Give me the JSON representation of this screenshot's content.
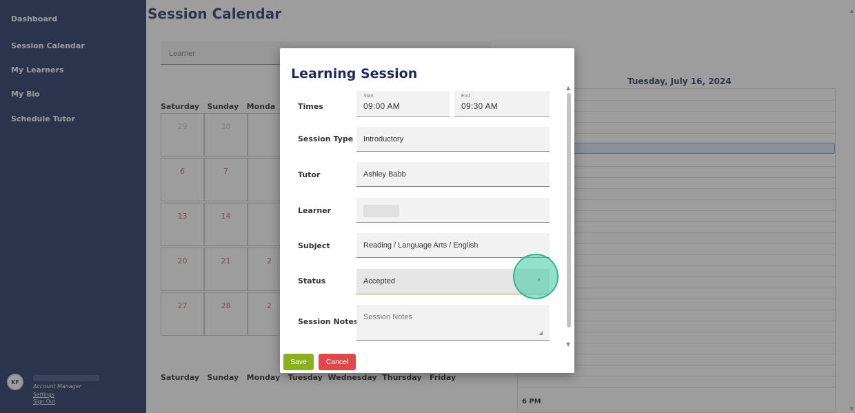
{
  "sidebar": {
    "items": [
      {
        "label": "Dashboard"
      },
      {
        "label": "Session Calendar"
      },
      {
        "label": "My Learners"
      },
      {
        "label": "My Bio"
      },
      {
        "label": "Schedule Tutor"
      }
    ],
    "account": {
      "initials": "KF",
      "role": "Account Manager",
      "settings": "Settings",
      "sign_out": "Sign Out"
    }
  },
  "page": {
    "title": "Session Calendar",
    "learner_placeholder": "Learner"
  },
  "calendar": {
    "header": "Saturday   Sunday   Monda",
    "bottom_header": "Saturday   Sunday   Monday   Tuesday  Wednesday  Thursday   Friday",
    "rows": [
      [
        "29",
        "30",
        ""
      ],
      [
        "6",
        "7",
        ""
      ],
      [
        "13",
        "14",
        ""
      ],
      [
        "20",
        "21",
        "2"
      ],
      [
        "27",
        "28",
        "2"
      ]
    ]
  },
  "day_view": {
    "title": "Tuesday, July 16, 2024",
    "time_label": "6 PM"
  },
  "modal": {
    "title": "Learning Session",
    "times": {
      "label": "Times",
      "start_label": "Start",
      "start_value": "09:00 AM",
      "end_label": "End",
      "end_value": "09:30 AM"
    },
    "session_type": {
      "label": "Session Type",
      "value": "Introductory"
    },
    "tutor": {
      "label": "Tutor",
      "value": "Ashley Babb"
    },
    "learner": {
      "label": "Learner"
    },
    "subject": {
      "label": "Subject",
      "value": "Reading / Language Arts / English"
    },
    "status": {
      "label": "Status",
      "value": "Accepted"
    },
    "notes": {
      "label": "Session Notes",
      "placeholder": "Session Notes"
    },
    "save_label": "Save",
    "cancel_label": "Cancel"
  },
  "colors": {
    "sidebar": "#1b2a5e",
    "title": "#1b2a5e",
    "save": "#8ab01f",
    "cancel": "#e04848",
    "highlight": "#2fb594"
  }
}
